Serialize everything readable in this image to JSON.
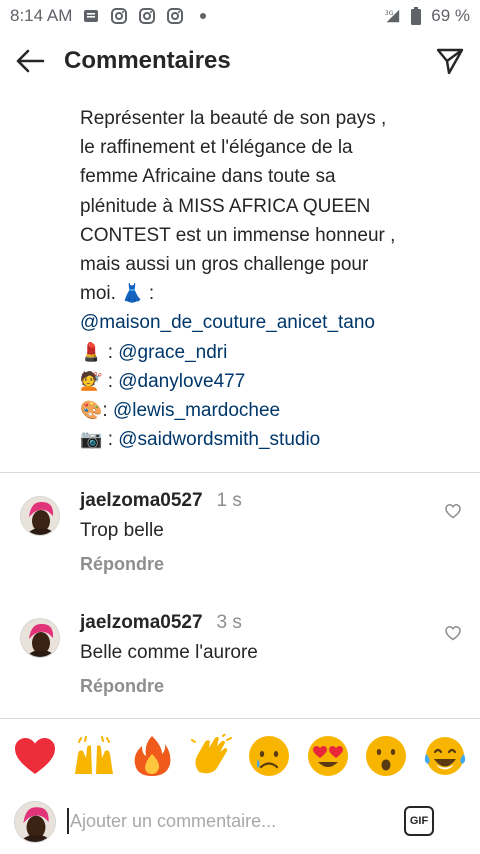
{
  "status_bar": {
    "time": "8:14 AM",
    "notification_icons": [
      "news-icon",
      "instagram-icon",
      "instagram-icon",
      "instagram-icon",
      "dot-icon"
    ],
    "network": "3G",
    "battery": "69 %"
  },
  "header": {
    "title": "Commentaires",
    "back_icon": "arrow-left-icon",
    "send_icon": "paper-plane-icon"
  },
  "caption": {
    "lines": [
      "Représenter la beauté de son pays ,",
      "le raffinement et l'élégance de la",
      "femme Africaine dans toute sa",
      "plénitude à MISS AFRICA QUEEN",
      "CONTEST est un immense honneur ,",
      "mais aussi un gros challenge pour",
      "moi."
    ],
    "credits": [
      {
        "icon": "dress-emoji",
        "glyph": "👗",
        "sep": " :",
        "mention": ""
      },
      {
        "icon": "",
        "glyph": "",
        "sep": "",
        "mention": "@maison_de_couture_anicet_tano"
      },
      {
        "icon": "lipstick-emoji",
        "glyph": "💄",
        "sep": " : ",
        "mention": "@grace_ndri"
      },
      {
        "icon": "hairdresser-emoji",
        "glyph": "💇",
        "sep": " : ",
        "mention": "@danylove477"
      },
      {
        "icon": "palette-emoji",
        "glyph": "🎨",
        "sep": ": ",
        "mention": "@lewis_mardochee"
      },
      {
        "icon": "camera-emoji",
        "glyph": "📷",
        "sep": " : ",
        "mention": "@saidwordsmith_studio"
      }
    ]
  },
  "comments": [
    {
      "username": "jaelzoma0527",
      "time": "1 s",
      "text": "Trop belle",
      "reply_label": "Répondre"
    },
    {
      "username": "jaelzoma0527",
      "time": "3 s",
      "text": "Belle comme l'aurore",
      "reply_label": "Répondre"
    }
  ],
  "reactions": [
    {
      "name": "heart",
      "glyph": "❤️",
      "color": "#ed4956"
    },
    {
      "name": "raised-hands",
      "glyph": "🙌",
      "color": "#f5b400"
    },
    {
      "name": "fire",
      "glyph": "🔥",
      "color": "#ff6a00"
    },
    {
      "name": "clapping-hands",
      "glyph": "👏",
      "color": "#f5b400"
    },
    {
      "name": "crying-face",
      "glyph": "😢",
      "color": "#f5b400"
    },
    {
      "name": "heart-eyes",
      "glyph": "😍",
      "color": "#f5b400"
    },
    {
      "name": "astonished-face",
      "glyph": "😮",
      "color": "#f5b400"
    },
    {
      "name": "tears-of-joy",
      "glyph": "😂",
      "color": "#f5b400"
    }
  ],
  "input": {
    "placeholder": "Ajouter un commentaire...",
    "value": "",
    "gif_label": "GIF"
  },
  "colors": {
    "text": "#262626",
    "secondary": "#8e8e8e",
    "mention": "#00376b",
    "divider": "#dbdbdb"
  }
}
